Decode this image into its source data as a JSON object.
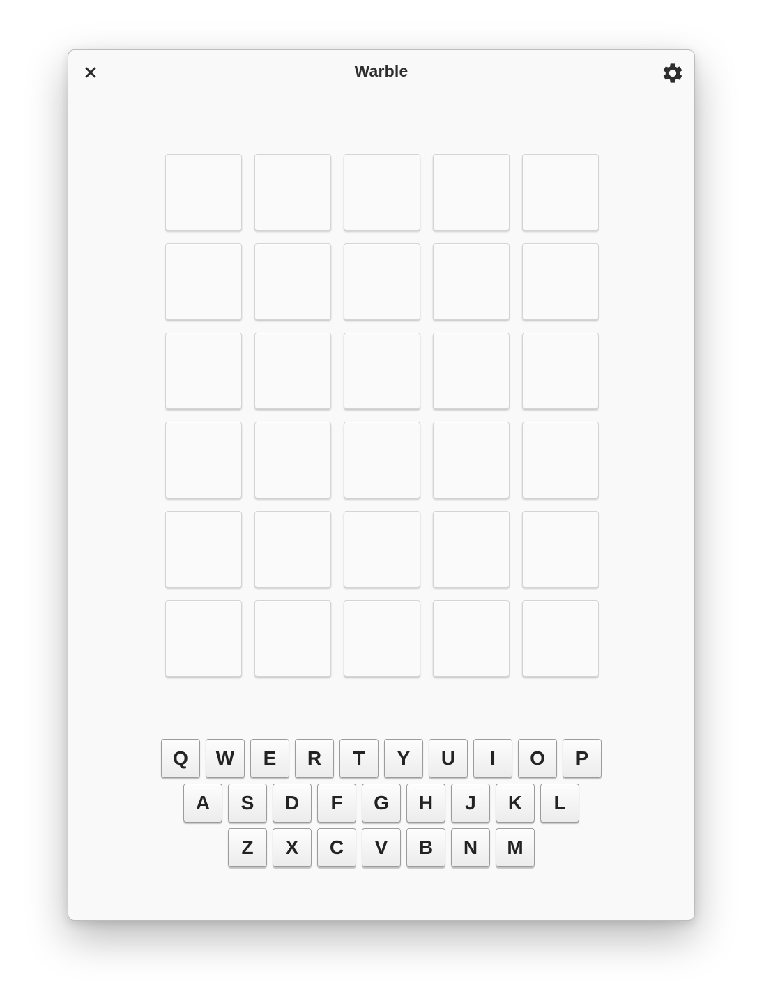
{
  "window": {
    "title": "Warble"
  },
  "icons": {
    "close": "close-icon",
    "settings": "gear-icon"
  },
  "board": {
    "rows": 6,
    "columns": 5,
    "tiles": [
      [
        "",
        "",
        "",
        "",
        ""
      ],
      [
        "",
        "",
        "",
        "",
        ""
      ],
      [
        "",
        "",
        "",
        "",
        ""
      ],
      [
        "",
        "",
        "",
        "",
        ""
      ],
      [
        "",
        "",
        "",
        "",
        ""
      ],
      [
        "",
        "",
        "",
        "",
        ""
      ]
    ]
  },
  "keyboard": {
    "rows": [
      [
        "Q",
        "W",
        "E",
        "R",
        "T",
        "Y",
        "U",
        "I",
        "O",
        "P"
      ],
      [
        "A",
        "S",
        "D",
        "F",
        "G",
        "H",
        "J",
        "K",
        "L"
      ],
      [
        "Z",
        "X",
        "C",
        "V",
        "B",
        "N",
        "M"
      ]
    ]
  },
  "colors": {
    "background": "#f9f9f9",
    "text": "#2e2e2e",
    "tile_border": "#d4d4d4",
    "key_border": "#9c9c9c"
  }
}
